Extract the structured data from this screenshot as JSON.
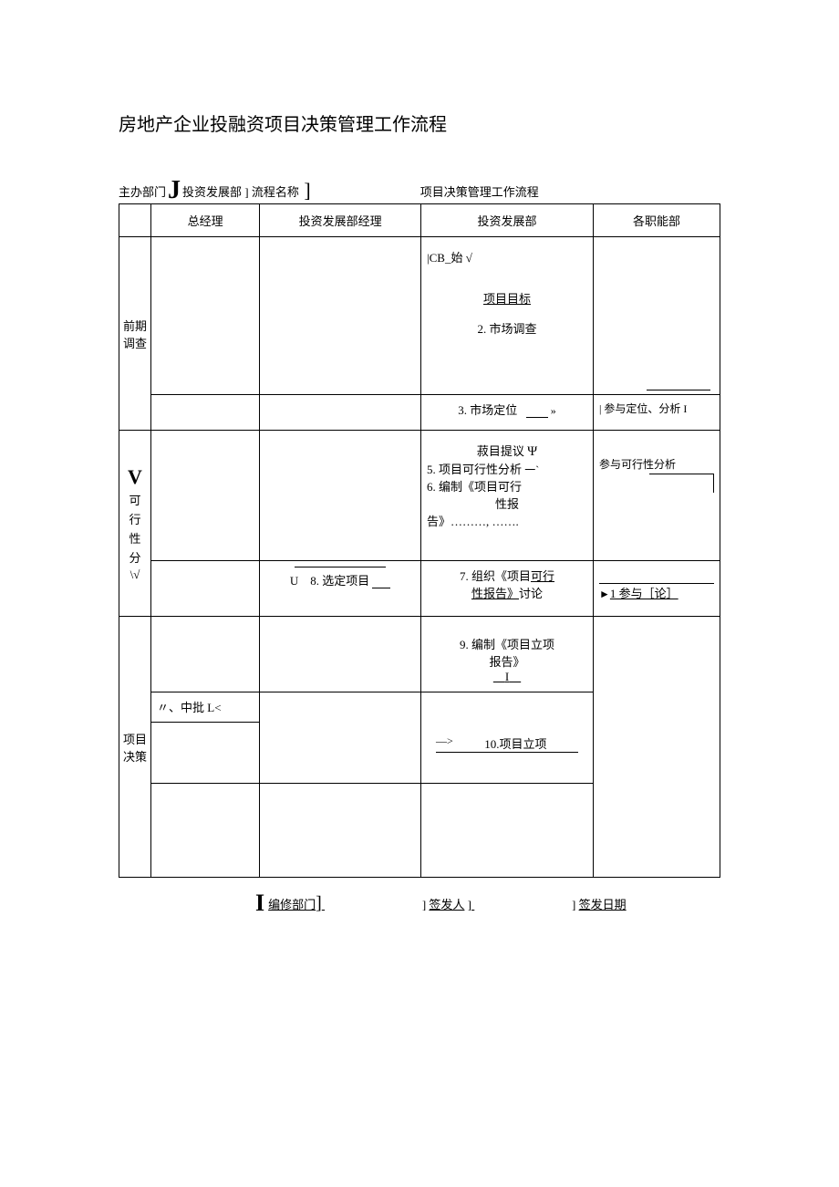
{
  "title": "房地产企业投融资项目决策管理工作流程",
  "meta": {
    "host_label": "主办部门",
    "host_value": "投资发展部",
    "flow_name_label": "流程名称",
    "flow_name_value": "项目决策管理工作流程"
  },
  "columns": {
    "c1": "总经理",
    "c2": "投资发展部经理",
    "c3": "投资发展部",
    "c4": "各职能部"
  },
  "phases": {
    "p1": "前期调查",
    "p2_char": "V",
    "p2": "可行性分\\√",
    "p3": "项目决策"
  },
  "cells": {
    "cb_start": "|CB_始 √",
    "goal": "项目目标",
    "step2": "2. 市场调查",
    "step3": "3. 市场定位",
    "step3_arrow": "»",
    "step3_right": "| 参与定位、分析 I",
    "suggest_prefix": "菽目提议",
    "suggest_sym": "Ψ",
    "step5": "5. 项目可行性分析",
    "step5_arrow": "一`",
    "step5_right": "参与可行性分析",
    "step6a": "6. 编制《项目可行",
    "step6b": "性报",
    "step6c": "告》………, …….",
    "step7a": "7. 组织《项目",
    "step7a_u": "可行",
    "step7b_u": "性报告》",
    "step7b": "讨论",
    "step8_u": "U",
    "step8": "8. 选定项目",
    "step8_rarrow": "►",
    "step8_right": "1 参与［论］",
    "step9a": "9. 编制《项目立项",
    "step9b": "报告》",
    "step9c": "I",
    "approve": "〃、中批 L<",
    "step10_arrow": "—>",
    "step10": "10.项目立项"
  },
  "footer": {
    "edit_dept": "编修部门",
    "signer": "签发人",
    "sign_date": "签发日期"
  }
}
